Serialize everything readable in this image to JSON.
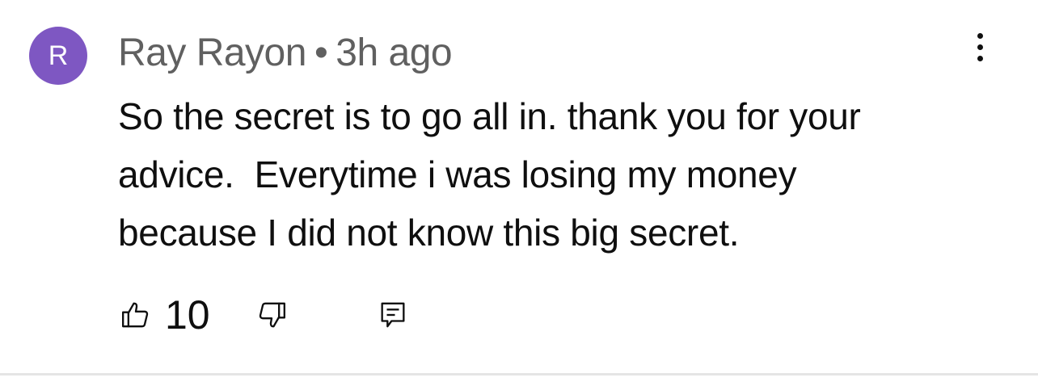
{
  "comment": {
    "avatar_letter": "R",
    "avatar_color": "#7e57c2",
    "author": "Ray Rayon",
    "separator": "•",
    "time": "3h ago",
    "text": "So the secret is to go all in. thank you for your\nadvice.  Everytime i was losing my money\nbecause I did not know this big secret.",
    "like_count": "10"
  },
  "icons": {
    "more": "more-vertical-icon",
    "like": "thumbs-up-icon",
    "dislike": "thumbs-down-icon",
    "reply": "reply-comment-icon"
  }
}
